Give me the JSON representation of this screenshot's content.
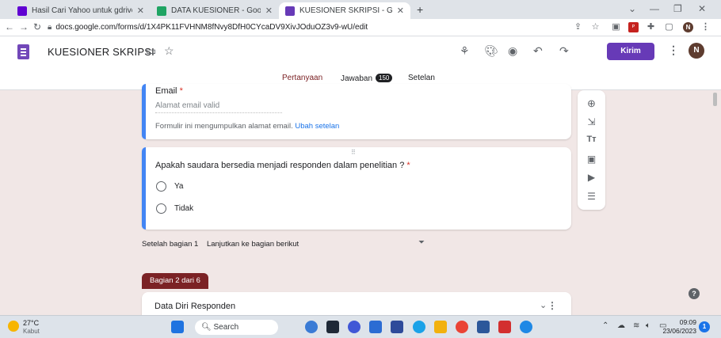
{
  "browser": {
    "tabs": [
      {
        "title": "Hasil Cari Yahoo untuk gdrive",
        "color": "#6001d2"
      },
      {
        "title": "DATA KUESIONER - Google Drive",
        "color": "#1fa463"
      },
      {
        "title": "KUESIONER SKRIPSI - Google Forms",
        "color": "#673ab7"
      }
    ],
    "new_tab": "+",
    "url": "docs.google.com/forms/d/1X4PK11FVHNM8fNvy8DfH0CYcaDV9XivJOduOZ3v9-wU/edit",
    "profile": "N"
  },
  "form_header": {
    "title": "KUESIONER SKRIPSI",
    "send_label": "Kirim",
    "avatar": "N",
    "tabs": [
      {
        "label": "Pertanyaan"
      },
      {
        "label": "Jawaban",
        "badge": "150"
      },
      {
        "label": "Setelan"
      }
    ]
  },
  "email_card": {
    "label": "Email",
    "required_mark": "*",
    "placeholder": "Alamat email valid",
    "note": "Formulir ini mengumpulkan alamat email.",
    "link": "Ubah setelan"
  },
  "question_card": {
    "drag_handle": "⠿",
    "question": "Apakah saudara bersedia menjadi responden dalam penelitian ?",
    "required_mark": "*",
    "options": [
      "Ya",
      "Tidak"
    ]
  },
  "after_section": {
    "label": "Setelah bagian 1",
    "value": "Lanjutkan ke bagian berikut"
  },
  "section2": {
    "tag": "Bagian 2 dari 6",
    "title": "Data Diri Responden"
  },
  "taskbar": {
    "weather_temp": "27°C",
    "weather_desc": "Kabut",
    "search_label": "Search",
    "time": "09:09",
    "date": "23/06/2023",
    "notif_count": "1"
  }
}
